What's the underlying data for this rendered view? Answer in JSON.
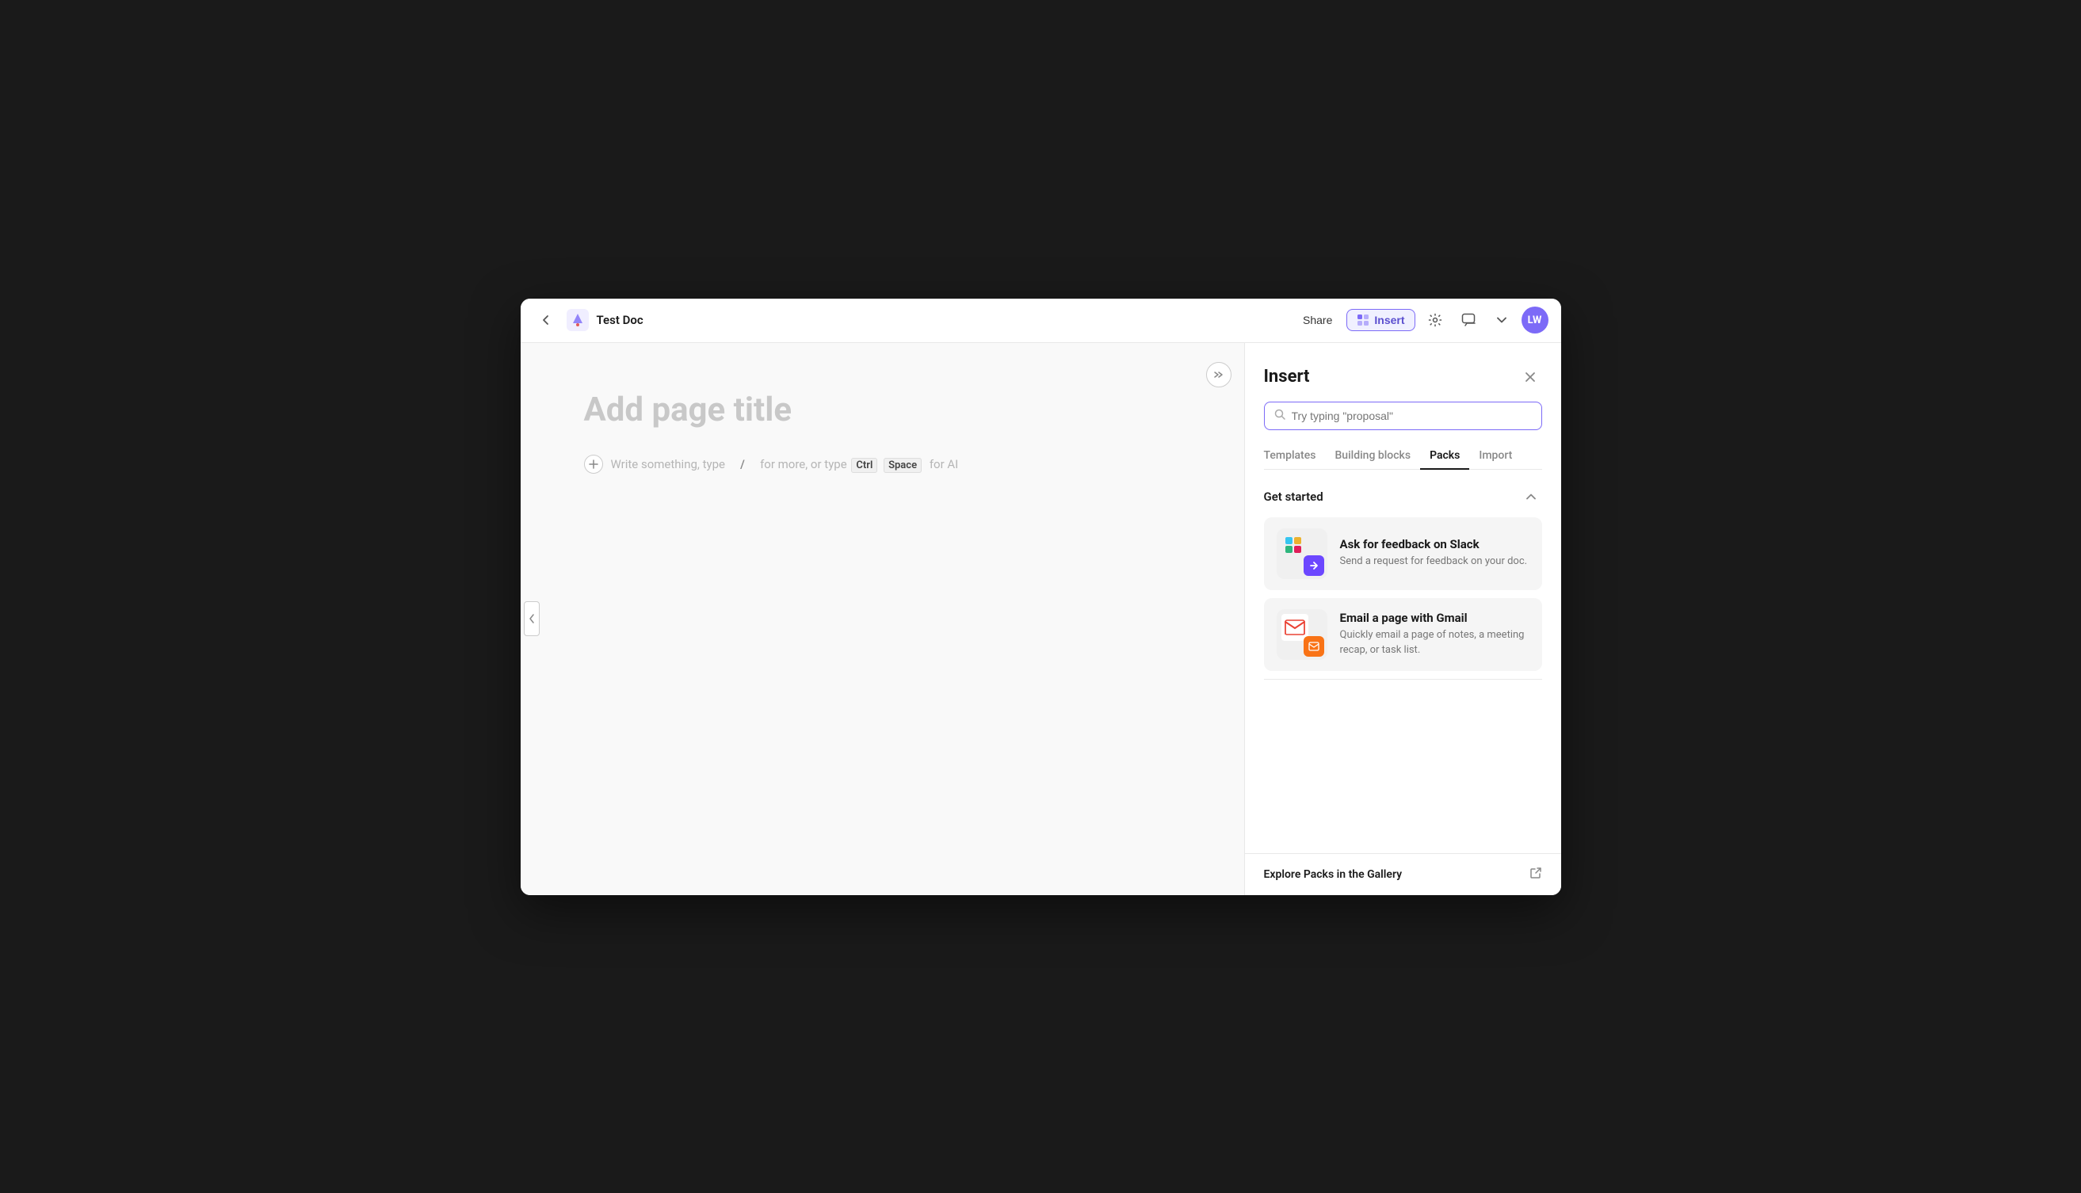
{
  "topbar": {
    "doc_title": "Test Doc",
    "share_label": "Share",
    "insert_label": "Insert",
    "avatar_initials": "LW"
  },
  "editor": {
    "page_title_placeholder": "Add page title",
    "hint_write": "Write something, type",
    "hint_slash": "/",
    "hint_more": "for more, or type",
    "hint_ctrl": "Ctrl",
    "hint_space": "Space",
    "hint_ai": "for AI"
  },
  "insert_panel": {
    "title": "Insert",
    "search_placeholder": "Try typing \"proposal\"",
    "tabs": [
      {
        "id": "templates",
        "label": "Templates"
      },
      {
        "id": "building-blocks",
        "label": "Building blocks"
      },
      {
        "id": "packs",
        "label": "Packs",
        "active": true
      },
      {
        "id": "import",
        "label": "Import"
      }
    ],
    "section_get_started": {
      "title": "Get started",
      "items": [
        {
          "id": "slack",
          "name": "Ask for feedback on Slack",
          "desc": "Send a request for feedback on your doc."
        },
        {
          "id": "gmail",
          "name": "Email a page with Gmail",
          "desc": "Quickly email a page of notes, a meeting recap, or task list."
        }
      ]
    },
    "explore_label": "Explore Packs in the Gallery"
  }
}
